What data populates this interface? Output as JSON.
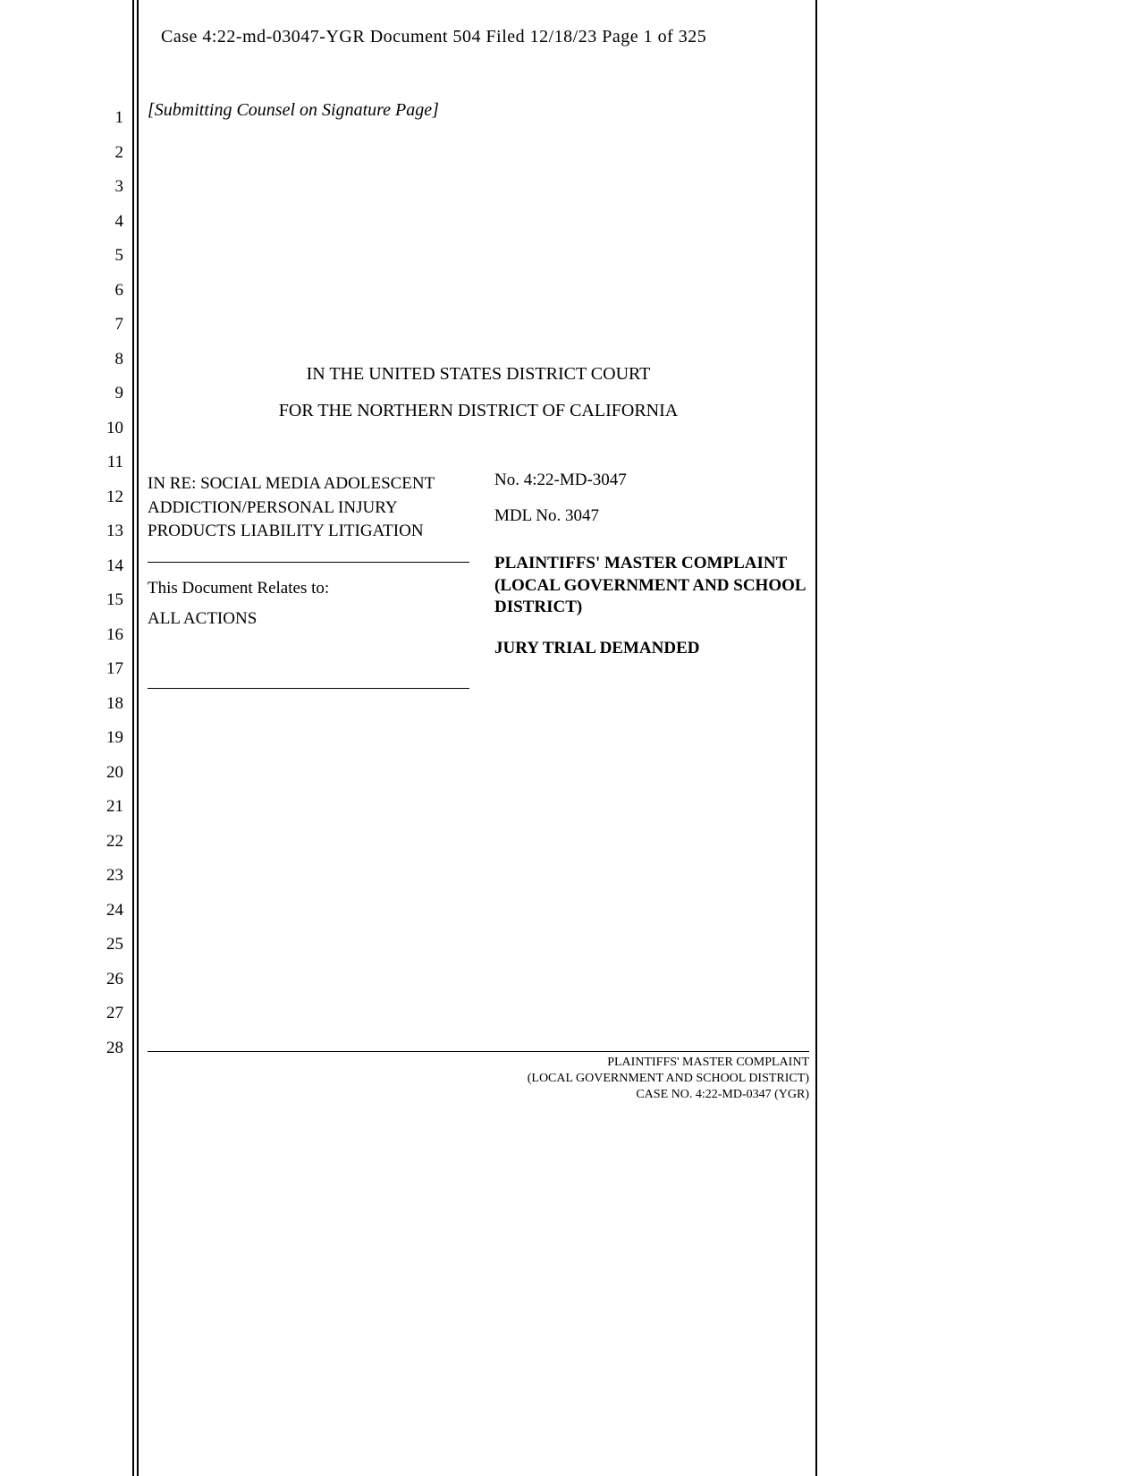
{
  "header": {
    "caption": "Case 4:22-md-03047-YGR   Document 504   Filed 12/18/23   Page 1 of 325"
  },
  "lineNumbers": [
    "1",
    "2",
    "3",
    "4",
    "5",
    "6",
    "7",
    "8",
    "9",
    "10",
    "11",
    "12",
    "13",
    "14",
    "15",
    "16",
    "17",
    "18",
    "19",
    "20",
    "21",
    "22",
    "23",
    "24",
    "25",
    "26",
    "27",
    "28"
  ],
  "counsel_note": "[Submitting Counsel on Signature Page]",
  "court": {
    "line1": "IN THE UNITED STATES DISTRICT COURT",
    "line2": "FOR THE NORTHERN DISTRICT OF CALIFORNIA"
  },
  "caption": {
    "case_name": "IN RE: SOCIAL MEDIA ADOLESCENT ADDICTION/PERSONAL INJURY PRODUCTS LIABILITY LITIGATION",
    "relates_label": "This Document Relates to:",
    "relates_value": "ALL ACTIONS",
    "case_no": "No. 4:22-MD-3047",
    "mdl_no": "MDL No. 3047",
    "title_line1": "PLAINTIFFS' MASTER COMPLAINT",
    "title_line2": "(LOCAL GOVERNMENT AND SCHOOL DISTRICT)",
    "jury": "JURY TRIAL DEMANDED"
  },
  "footer": {
    "line1": "PLAINTIFFS' MASTER COMPLAINT",
    "line2": "(LOCAL GOVERNMENT AND SCHOOL DISTRICT)",
    "line3": "CASE NO. 4:22-MD-0347 (YGR)"
  }
}
